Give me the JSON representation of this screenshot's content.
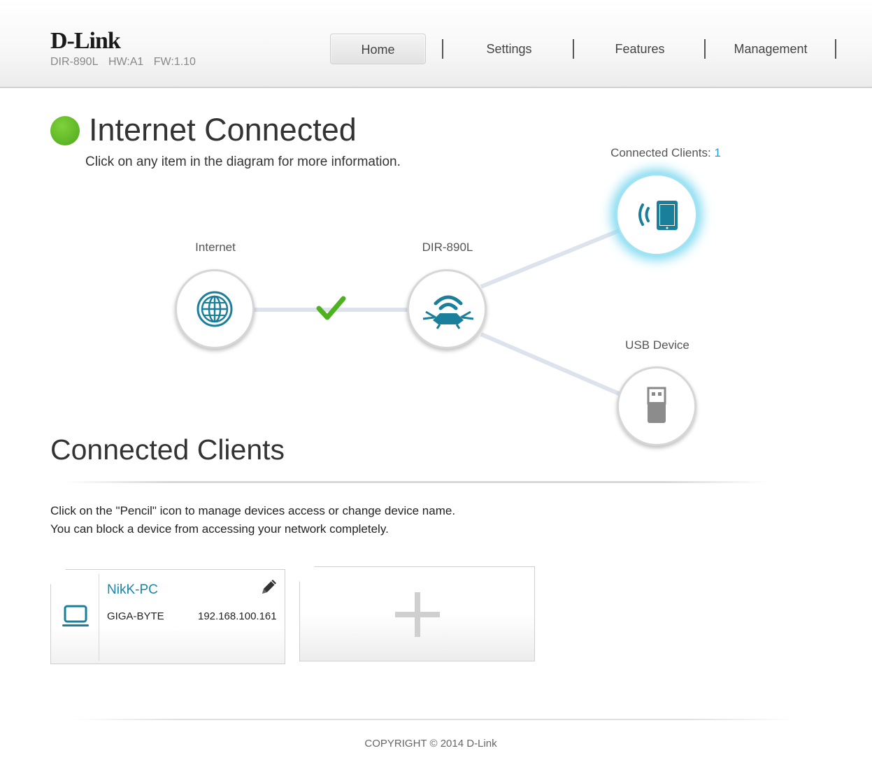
{
  "header": {
    "brand": "D-Link",
    "model": "DIR-890L",
    "hw": "HW:A1",
    "fw": "FW:1.10"
  },
  "nav": [
    {
      "label": "Home",
      "active": true
    },
    {
      "label": "Settings",
      "active": false
    },
    {
      "label": "Features",
      "active": false
    },
    {
      "label": "Management",
      "active": false
    }
  ],
  "status": {
    "title": "Internet Connected",
    "subtitle": "Click on any item in the diagram for more information.",
    "color": "#5cb827"
  },
  "diagram": {
    "internet_label": "Internet",
    "router_label": "DIR-890L",
    "clients_label": "Connected Clients:",
    "clients_count": "1",
    "usb_label": "USB Device",
    "accent": "#1a7f9a",
    "link_status_icon": "checkmark-icon"
  },
  "clients_section": {
    "title": "Connected Clients",
    "help_line1": "Click on the \"Pencil\" icon to manage devices access or change device name.",
    "help_line2": "You can block a device from accessing your network completely."
  },
  "clients": [
    {
      "name": "NikK-PC",
      "vendor": "GIGA-BYTE",
      "ip": "192.168.100.161",
      "icon": "laptop-icon"
    }
  ],
  "footer": {
    "copyright": "COPYRIGHT © 2014 D-Link"
  }
}
